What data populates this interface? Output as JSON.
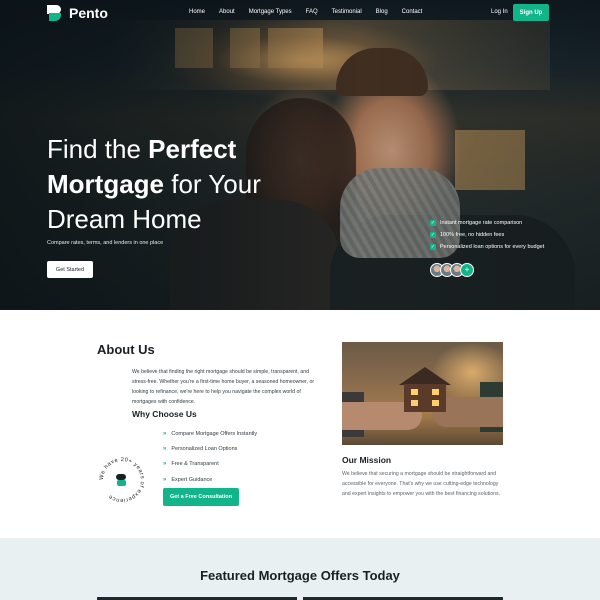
{
  "brand": {
    "name": "Pento",
    "accent": "#12b48a"
  },
  "nav": {
    "links": [
      "Home",
      "About",
      "Mortgage Types",
      "FAQ",
      "Testimonial",
      "Blog",
      "Contact"
    ],
    "login": "Log In",
    "signup": "Sign Up"
  },
  "hero": {
    "title_part1": "Find the ",
    "title_bold1": "Perfect",
    "title_bold2": "Mortgage",
    "title_part2": " for Your",
    "title_part3": "Dream Home",
    "subtitle": "Compare rates, terms, and lenders in one place",
    "button": "Get Started",
    "features": [
      "Instant mortgage rate comparison",
      "100% free, no hidden fees",
      "Personalized loan options for every budget"
    ],
    "avatar_plus": "+"
  },
  "about": {
    "title_bold": "About",
    "title_rest": " Us",
    "text": "We believe that finding the right mortgage should be simple, transparent, and stress-free. Whether you're a first-time home buyer, a seasoned homeowner, or looking to refinance, we're here to help you navigate the complex world of mortgages with confidence.",
    "why_title": "Why Choose Us",
    "reasons": [
      "Compare Mortgage Offers Instantly",
      "Personalized Loan Options",
      "Free & Transparent",
      "Expert Guidance"
    ],
    "cta": "Get a Free Consultation",
    "badge_text": "We have 20+ years of experience"
  },
  "mission": {
    "title": "Our Mission",
    "text": "We believe that securing a mortgage should be straightforward and accessible for everyone. That's why we use cutting-edge technology and expert insights to empower you with the best financing solutions."
  },
  "featured": {
    "title_bold": "Featured",
    "title_rest": " Mortgage Offers Today"
  }
}
